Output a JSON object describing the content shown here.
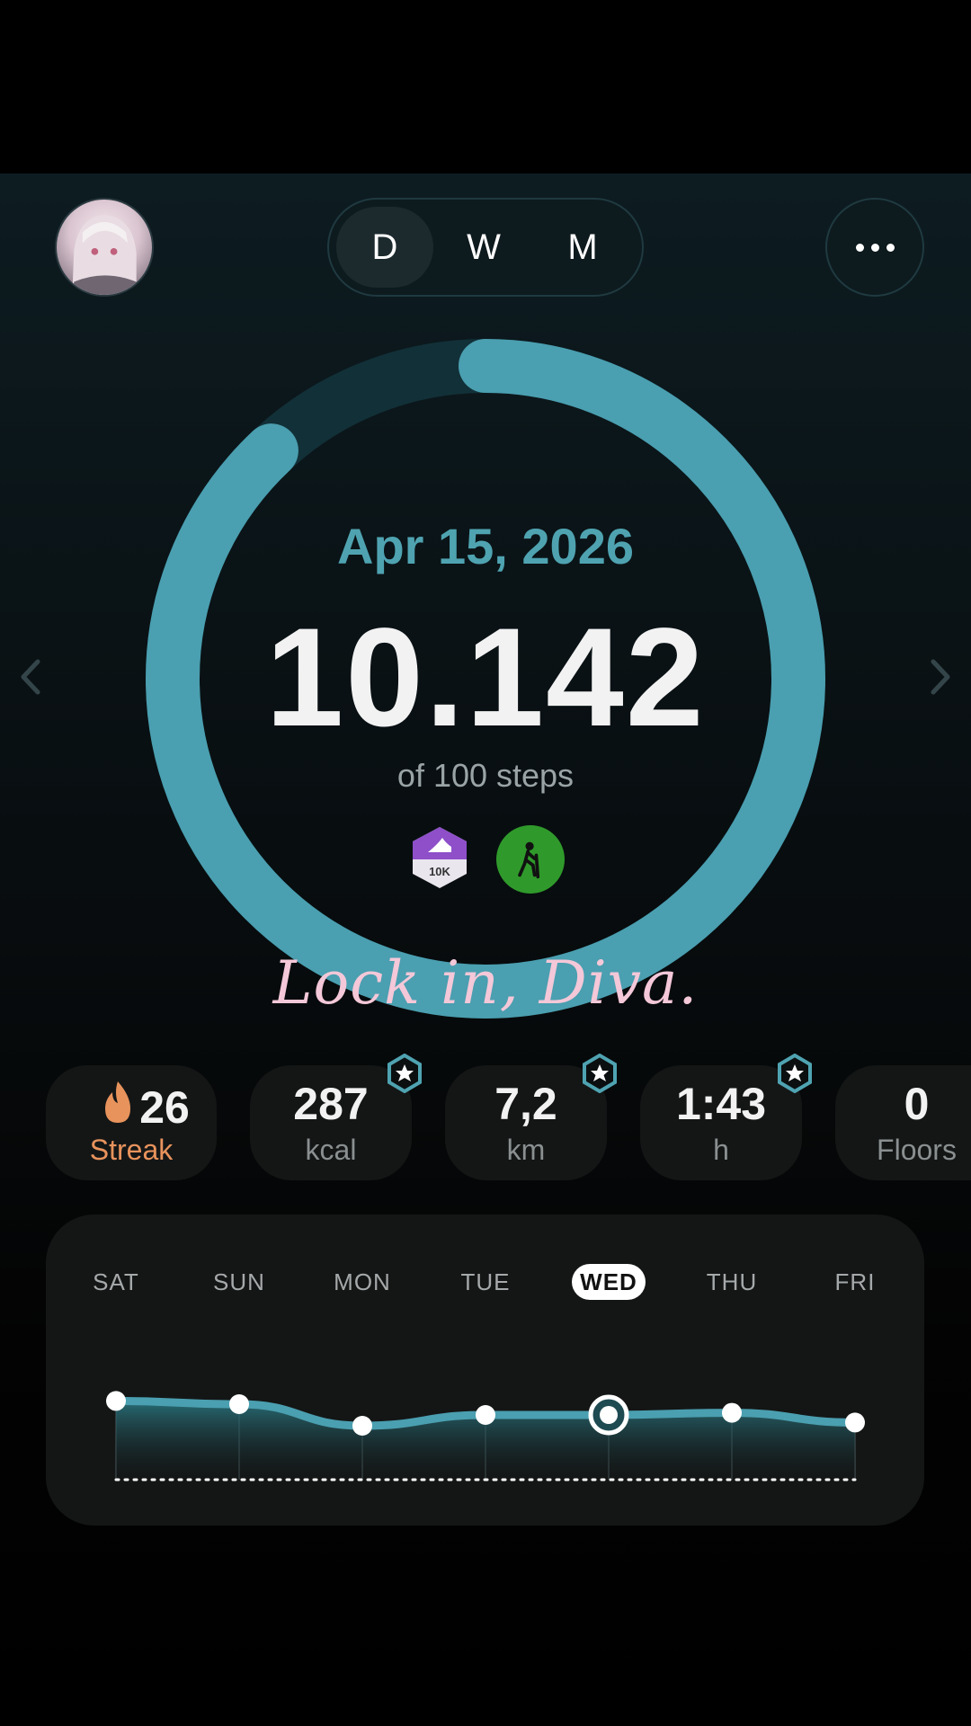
{
  "header": {
    "period_tabs": [
      {
        "label": "D",
        "active": true
      },
      {
        "label": "W",
        "active": false
      },
      {
        "label": "M",
        "active": false
      }
    ]
  },
  "summary": {
    "date": "Apr 15, 2026",
    "steps": "10.142",
    "goal_text": "of 100 steps",
    "ring_progress": 0.88,
    "badges": [
      {
        "icon": "shoe-10k-badge-icon",
        "label": "10K"
      },
      {
        "icon": "hiker-badge-icon"
      }
    ],
    "motto": "Lock in, Diva."
  },
  "stats": [
    {
      "value": "26",
      "label": "Streak",
      "icon": "flame-icon",
      "starred": false
    },
    {
      "value": "287",
      "label": "kcal",
      "starred": true
    },
    {
      "value": "7,2",
      "label": "km",
      "starred": true
    },
    {
      "value": "1:43",
      "label": "h",
      "starred": true
    },
    {
      "value": "0",
      "label": "Floors",
      "starred": false
    }
  ],
  "weekly": {
    "days": [
      "SAT",
      "SUN",
      "MON",
      "TUE",
      "WED",
      "THU",
      "FRI"
    ],
    "selected": "WED",
    "trend": [
      0.73,
      0.7,
      0.5,
      0.6,
      0.6,
      0.62,
      0.53
    ]
  },
  "colors": {
    "accent": "#4fa3b1",
    "streak": "#e8935c",
    "hike_badge": "#2f9a2b",
    "badge_purple": "#8e4fc9",
    "motto": "#f4c8d8"
  }
}
